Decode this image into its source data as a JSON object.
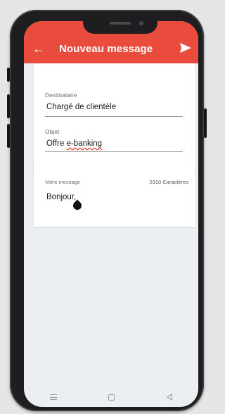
{
  "colors": {
    "accent": "#e94b3c",
    "screen_bg": "#eceff2"
  },
  "appbar": {
    "title": "Nouveau message",
    "back_icon": "arrow-left-icon",
    "send_icon": "send-icon"
  },
  "form": {
    "recipient": {
      "label": "Destinataire",
      "value": "Chargé de clientèle"
    },
    "subject": {
      "label": "Objet",
      "value_prefix": "Offre ",
      "value_misspelled": "e-banking"
    },
    "message": {
      "label": "Votre message",
      "counter": "2910 Caractères",
      "value": "Bonjour,"
    }
  },
  "navbar": {
    "items": [
      "menu-icon",
      "home-icon",
      "back-icon"
    ]
  }
}
